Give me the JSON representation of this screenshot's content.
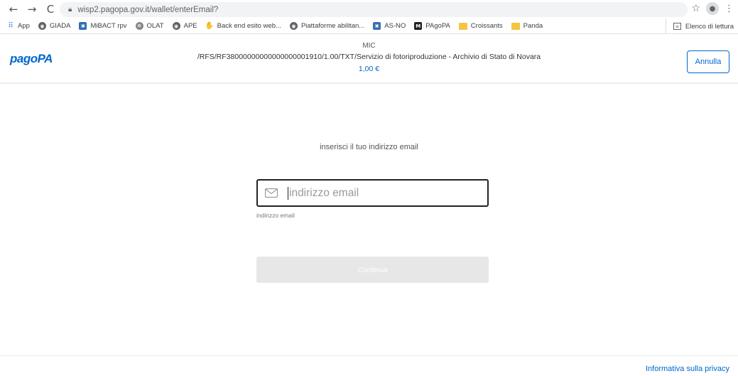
{
  "browser": {
    "url": "wisp2.pagopa.gov.it/wallet/enterEmail?",
    "back_icon": "←",
    "forward_icon": "→",
    "reload_icon": "C",
    "bookmarks": [
      {
        "label": "App",
        "icon": "apps-grid"
      },
      {
        "label": "GIADA",
        "icon": "globe"
      },
      {
        "label": "MiBACT rpv",
        "icon": "mibact"
      },
      {
        "label": "OLAT",
        "icon": "olat"
      },
      {
        "label": "APE",
        "icon": "globe"
      },
      {
        "label": "Back end esito web...",
        "icon": "hand"
      },
      {
        "label": "Piattaforme abilitan...",
        "icon": "globe"
      },
      {
        "label": "AS-NO",
        "icon": "asno"
      },
      {
        "label": "PAgoPA",
        "icon": "pagopa"
      },
      {
        "label": "Croissants",
        "icon": "folder"
      },
      {
        "label": "Panda",
        "icon": "folder"
      }
    ],
    "reading_list": "Elenco di lettura"
  },
  "header": {
    "logo": "pagoPA",
    "entity": "MIC",
    "description": "/RFS/RF38000000000000000001910/1.00/TXT/Servizio di fotoriproduzione - Archivio di Stato di Novara",
    "amount": "1,00 €",
    "cancel_label": "Annulla"
  },
  "form": {
    "prompt": "inserisci il tuo indirizzo email",
    "email_placeholder": "indirizzo email",
    "email_value": "",
    "email_help": "indirizzo email",
    "continue_label": "Continua"
  },
  "footer": {
    "privacy_link": "Informativa sulla privacy"
  },
  "colors": {
    "brand": "#0066cc",
    "disabled_button": "#e7e7e7"
  }
}
